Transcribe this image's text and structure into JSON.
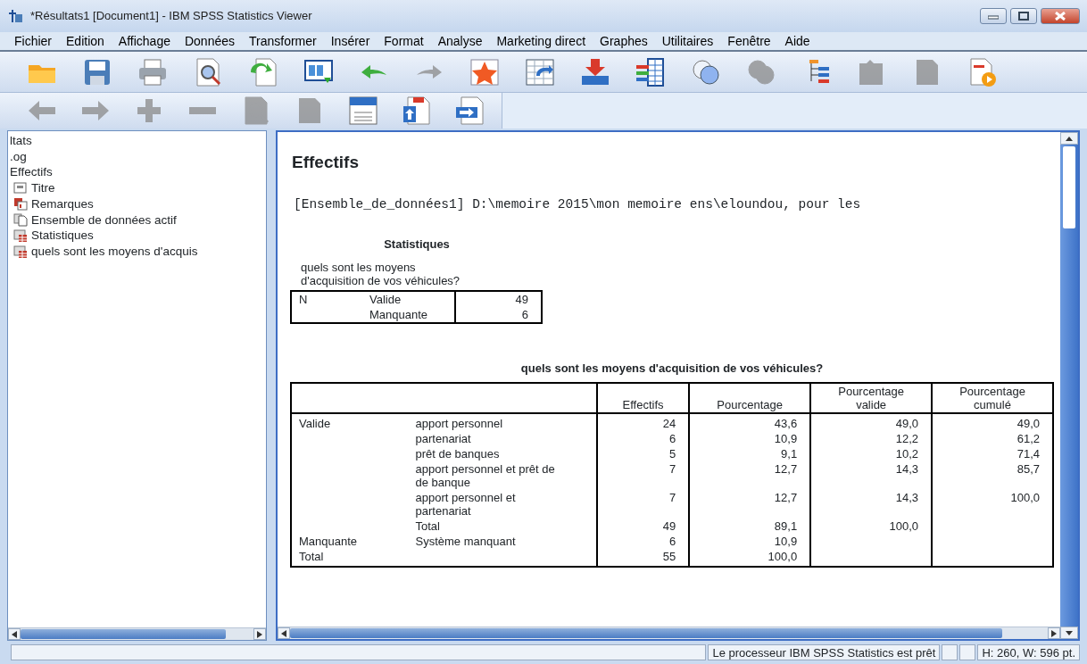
{
  "window": {
    "title": "*Résultats1 [Document1] - IBM SPSS Statistics Viewer"
  },
  "menu": [
    "Fichier",
    "Edition",
    "Affichage",
    "Données",
    "Transformer",
    "Insérer",
    "Format",
    "Analyse",
    "Marketing direct",
    "Graphes",
    "Utilitaires",
    "Fenêtre",
    "Aide"
  ],
  "toolbars": [
    [
      {
        "kind": "folder",
        "disabled": false
      },
      {
        "kind": "save",
        "disabled": false
      },
      {
        "kind": "print",
        "disabled": false
      },
      {
        "kind": "preview",
        "disabled": false
      },
      {
        "kind": "recall",
        "disabled": false
      },
      {
        "kind": "dialog",
        "disabled": false
      },
      {
        "kind": "undo",
        "disabled": false
      },
      {
        "kind": "redo",
        "disabled": true
      },
      {
        "kind": "star",
        "disabled": false
      },
      {
        "kind": "goto",
        "disabled": false
      },
      {
        "kind": "insert",
        "disabled": false
      },
      {
        "kind": "variables",
        "disabled": false
      },
      {
        "kind": "circles",
        "disabled": false
      },
      {
        "kind": "circles",
        "disabled": true
      },
      {
        "kind": "tree",
        "disabled": false
      },
      {
        "kind": "pages",
        "disabled": true
      },
      {
        "kind": "page",
        "disabled": true
      },
      {
        "kind": "play",
        "disabled": false
      }
    ],
    [
      {
        "kind": "left",
        "disabled": true
      },
      {
        "kind": "right",
        "disabled": true
      },
      {
        "kind": "plus",
        "disabled": true
      },
      {
        "kind": "minus",
        "disabled": true
      },
      {
        "kind": "preview",
        "disabled": true
      },
      {
        "kind": "page",
        "disabled": true
      },
      {
        "kind": "heading",
        "disabled": false
      },
      {
        "kind": "upload",
        "disabled": false
      },
      {
        "kind": "export",
        "disabled": false
      }
    ]
  ],
  "outline": [
    {
      "label": "ltats",
      "children": [
        {
          "label": ".og"
        },
        {
          "label": "Effectifs",
          "children": [
            {
              "label": "Titre",
              "kind": "title"
            },
            {
              "label": "Remarques",
              "kind": "notes"
            },
            {
              "label": "Ensemble de données actif",
              "kind": "dataset"
            },
            {
              "label": "Statistiques",
              "kind": "table"
            },
            {
              "label": "quels sont les moyens d'acquis",
              "kind": "table"
            }
          ]
        }
      ]
    }
  ],
  "output": {
    "heading": "Effectifs",
    "dataset_line": "[Ensemble_de_données1] D:\\memoire 2015\\mon memoire ens\\eloundou, pour les",
    "statistics": {
      "title": "Statistiques",
      "caption": "quels sont les moyens d'acquisition de vos véhicules?",
      "rows": [
        [
          "N",
          "Valide",
          "49"
        ],
        [
          "",
          "Manquante",
          "6"
        ]
      ]
    },
    "frequencies": {
      "title": "quels sont les moyens d'acquisition de vos véhicules?",
      "columns": [
        "",
        "",
        "Effectifs",
        "Pourcentage",
        "Pourcentage valide",
        "Pourcentage cumulé"
      ],
      "rows": [
        [
          "Valide",
          "apport personnel",
          "24",
          "43,6",
          "49,0",
          "49,0"
        ],
        [
          "",
          "partenariat",
          "6",
          "10,9",
          "12,2",
          "61,2"
        ],
        [
          "",
          "prêt de banques",
          "5",
          "9,1",
          "10,2",
          "71,4"
        ],
        [
          "",
          "apport personnel et prêt de de banque",
          "7",
          "12,7",
          "14,3",
          "85,7"
        ],
        [
          "",
          "apport personnel et partenariat",
          "7",
          "12,7",
          "14,3",
          "100,0"
        ],
        [
          "",
          "Total",
          "49",
          "89,1",
          "100,0",
          ""
        ],
        [
          "Manquante",
          "Système manquant",
          "6",
          "10,9",
          "",
          ""
        ],
        [
          "Total",
          "",
          "55",
          "100,0",
          "",
          ""
        ]
      ]
    }
  },
  "status_bar": {
    "message": "Le processeur IBM SPSS Statistics  est prêt",
    "size": "H: 260, W: 596 pt."
  }
}
